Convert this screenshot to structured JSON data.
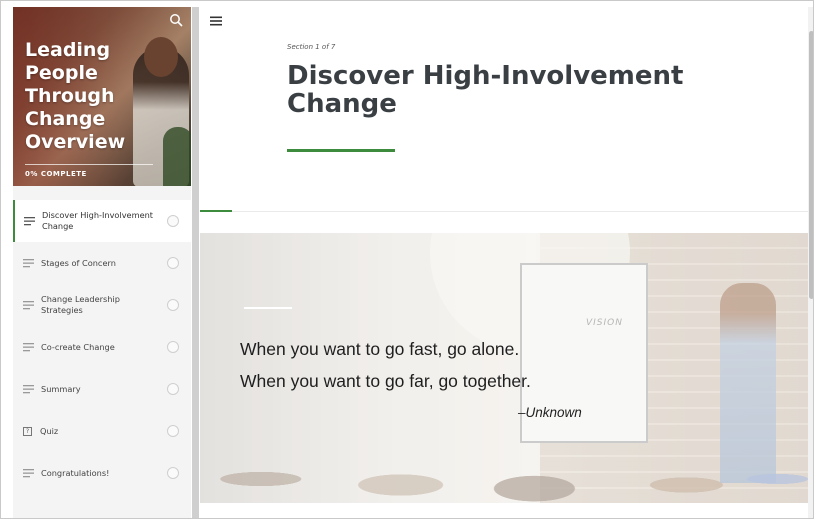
{
  "sidebar": {
    "course_title": "Leading People Through Change Overview",
    "progress_text": "0% COMPLETE",
    "items": [
      {
        "label": "Discover High-Involvement Change",
        "active": true,
        "icon": "lines-icon"
      },
      {
        "label": "Stages of Concern",
        "active": false,
        "icon": "lines-icon"
      },
      {
        "label": "Change Leadership Strategies",
        "active": false,
        "icon": "lines-icon"
      },
      {
        "label": "Co-create Change",
        "active": false,
        "icon": "lines-icon"
      },
      {
        "label": "Summary",
        "active": false,
        "icon": "lines-icon"
      },
      {
        "label": "Quiz",
        "active": false,
        "icon": "quiz-icon"
      },
      {
        "label": "Congratulations!",
        "active": false,
        "icon": "lines-icon"
      }
    ]
  },
  "main": {
    "section_label": "Section 1 of 7",
    "title": "Discover High-Involvement Change",
    "quote_line1": "When you want to go fast, go alone.",
    "quote_line2": "When you want to go far, go together.",
    "attribution": "–Unknown",
    "board_text": "VISION"
  },
  "colors": {
    "accent": "#3d8b3d",
    "title_text": "#3a3f44",
    "sidebar_bg": "#f4f4f4"
  }
}
